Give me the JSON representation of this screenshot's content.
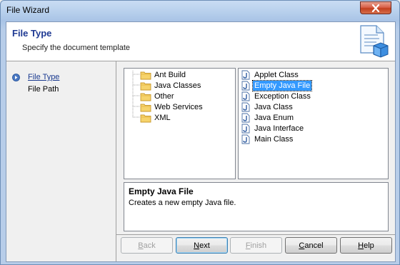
{
  "window": {
    "title": "File Wizard",
    "close_icon": "close-icon"
  },
  "header": {
    "title": "File Type",
    "subtitle": "Specify the document template",
    "icon": "document-wizard-icon"
  },
  "steps": [
    {
      "label": "File Type",
      "active": true
    },
    {
      "label": "File Path",
      "active": false
    }
  ],
  "categories": [
    "Ant Build",
    "Java Classes",
    "Other",
    "Web Services",
    "XML"
  ],
  "templates": [
    {
      "label": "Applet Class",
      "selected": false
    },
    {
      "label": "Empty Java File",
      "selected": true
    },
    {
      "label": "Exception Class",
      "selected": false
    },
    {
      "label": "Java Class",
      "selected": false
    },
    {
      "label": "Java Enum",
      "selected": false
    },
    {
      "label": "Java Interface",
      "selected": false
    },
    {
      "label": "Main Class",
      "selected": false
    }
  ],
  "description": {
    "title": "Empty Java File",
    "text": "Creates a new empty Java file."
  },
  "buttons": {
    "back": {
      "label": "Back",
      "underline": "B",
      "rest": "ack",
      "enabled": false
    },
    "next": {
      "label": "Next",
      "underline": "N",
      "rest": "ext",
      "enabled": true
    },
    "finish": {
      "label": "Finish",
      "underline": "F",
      "rest": "inish",
      "enabled": false
    },
    "cancel": {
      "label": "Cancel",
      "underline": "C",
      "rest": "ancel",
      "enabled": true
    },
    "help": {
      "label": "Help",
      "underline": "H",
      "rest": "elp",
      "enabled": true
    }
  }
}
